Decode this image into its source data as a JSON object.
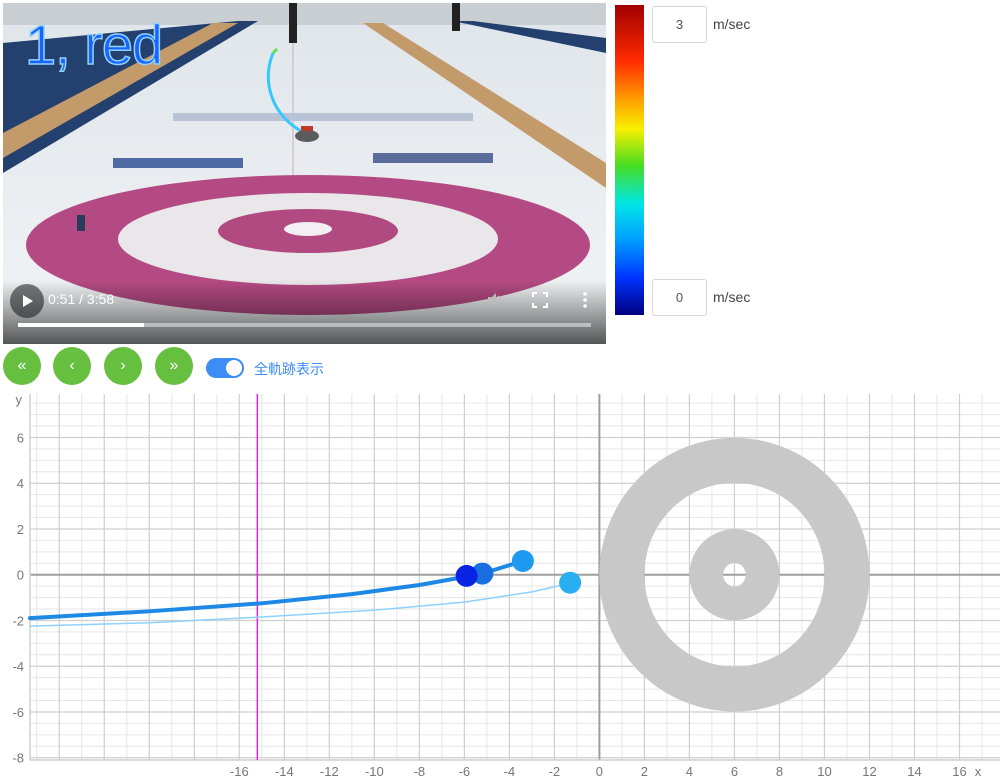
{
  "video": {
    "overlay_label": "1, red",
    "time_display": "0:51 / 3:58",
    "progress_fraction": 0.22
  },
  "speed_scale": {
    "max_value": "3",
    "min_value": "0",
    "unit": "m/sec"
  },
  "controls": {
    "first_label": "«",
    "prev_label": "‹",
    "next_label": "›",
    "last_label": "»",
    "toggle_label": "全軌跡表示",
    "toggle_on": true
  },
  "plot": {
    "x_axis_label": "x",
    "y_axis_label": "y",
    "x_ticks": [
      -16,
      -14,
      -12,
      -10,
      -8,
      -6,
      -4,
      -2,
      0,
      2,
      4,
      6,
      8,
      10,
      12,
      14,
      16
    ],
    "y_ticks": [
      -8,
      -6,
      -4,
      -2,
      0,
      2,
      4,
      6
    ],
    "xlim": [
      -25.3,
      17.8
    ],
    "ylim": [
      -8.1,
      7.9
    ],
    "hog_line_x": -15.2,
    "house": {
      "center_x": 6,
      "center_y": 0,
      "ring_radii": [
        6,
        4,
        2,
        0.5
      ]
    },
    "trajectories": [
      {
        "points": [
          [
            -25.3,
            -1.9
          ],
          [
            -20,
            -1.6
          ],
          [
            -15,
            -1.25
          ],
          [
            -11,
            -0.85
          ],
          [
            -8,
            -0.45
          ],
          [
            -6,
            -0.1
          ],
          [
            -5.2,
            0.05
          ],
          [
            -3.4,
            0.6
          ]
        ],
        "color": "#1e88e5",
        "width": 4
      },
      {
        "points": [
          [
            -25.3,
            -2.25
          ],
          [
            -20,
            -2.1
          ],
          [
            -15,
            -1.85
          ],
          [
            -10,
            -1.55
          ],
          [
            -6,
            -1.2
          ],
          [
            -3,
            -0.75
          ],
          [
            -1.2,
            -0.35
          ]
        ],
        "color": "#8fd0ff",
        "width": 1.5
      }
    ],
    "stones": [
      {
        "x": -3.4,
        "y": 0.6,
        "color": "#1e9bf0"
      },
      {
        "x": -1.3,
        "y": -0.35,
        "color": "#29aef2"
      },
      {
        "x": -5.2,
        "y": 0.05,
        "color": "#1a6fe0"
      },
      {
        "x": -5.9,
        "y": -0.05,
        "color": "#0a24e6"
      }
    ],
    "colors": {
      "grid_major": "#cfcfcf",
      "grid_minor": "#e6e6e6",
      "axis": "#9e9e9e",
      "hog_line": "#ff00ff",
      "house": "#c8c8c8"
    }
  }
}
